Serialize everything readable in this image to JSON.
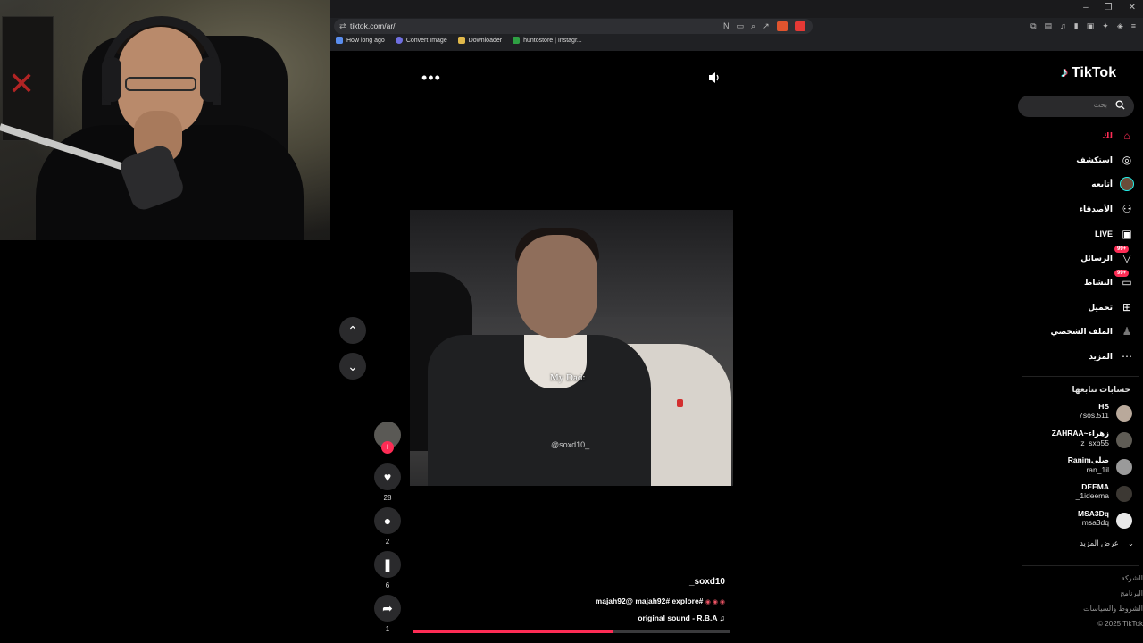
{
  "browser": {
    "url": "tiktok.com/ar/",
    "bookmarks": [
      "How long ago",
      "Convert Image",
      "Downloader",
      "huntostore | Instagr..."
    ],
    "bookmark_colors": [
      "#5a8dee",
      "#6f6fe0",
      "#e0b84a",
      "#2ea043"
    ]
  },
  "video": {
    "caption": "My Dad:",
    "watermark": "@soxd10_",
    "author": "_soxd10",
    "description": "majah92@ majah92# explore#",
    "description_emojis": "◉ ◉ ◉",
    "sound": "original sound - R.B.A",
    "progress_fraction": 0.63
  },
  "actions": {
    "likes": "28",
    "comments": "2",
    "saves": "6",
    "shares": "1"
  },
  "sidebar": {
    "logo": "TikTok",
    "search_placeholder": "بحث",
    "nav": [
      {
        "label": "لك",
        "icon": "home-icon",
        "active": true
      },
      {
        "label": "استكشف",
        "icon": "compass-icon"
      },
      {
        "label": "أتابعه",
        "icon": "following-avatar-icon"
      },
      {
        "label": "الأصدقاء",
        "icon": "friends-icon"
      },
      {
        "label": "LIVE",
        "icon": "live-icon"
      },
      {
        "label": "الرسائل",
        "icon": "messages-icon",
        "badge": "99+"
      },
      {
        "label": "النشاط",
        "icon": "activity-icon",
        "badge": "99+"
      },
      {
        "label": "تحميل",
        "icon": "upload-icon"
      },
      {
        "label": "الملف الشخصي",
        "icon": "profile-icon"
      },
      {
        "label": "المزيد",
        "icon": "more-icon"
      }
    ],
    "following_title": "حسابات تتابعها",
    "following": [
      {
        "name": "HS",
        "handle": "7sos.511"
      },
      {
        "name": "ZAHRAA~زهراء",
        "handle": "z_sxb55"
      },
      {
        "name": "Ranimصلى",
        "handle": "ran_1il"
      },
      {
        "name": "DEEMA",
        "handle": "_1ideema"
      },
      {
        "name": "MSA3Dq",
        "handle": "msa3dq"
      }
    ],
    "show_more": "عرض المزيد",
    "footer": [
      "الشركة",
      "البرنامج",
      "الشروط والسياسات",
      "© 2025 TikTok"
    ]
  },
  "colors": {
    "accent": "#fe2c55",
    "cyan": "#25f4ee"
  }
}
